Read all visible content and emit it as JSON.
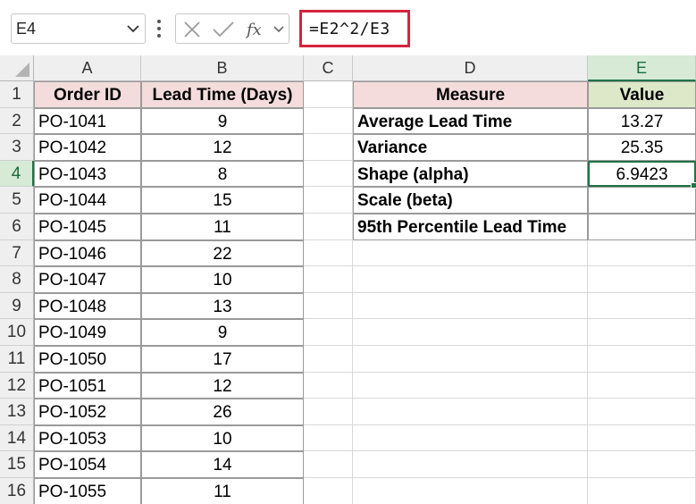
{
  "formula_bar": {
    "name_box": "E4",
    "formula": "=E2^2/E3",
    "icons": [
      "chevron-down-icon",
      "more-vertical-icon",
      "cancel-icon",
      "enter-check-icon",
      "function-icon"
    ]
  },
  "columns": [
    "A",
    "B",
    "C",
    "D",
    "E"
  ],
  "rows": [
    "1",
    "2",
    "3",
    "4",
    "5",
    "6",
    "7",
    "8",
    "9",
    "10",
    "11",
    "12",
    "13",
    "14",
    "15",
    "16"
  ],
  "table_left": {
    "headers": [
      "Order ID",
      "Lead Time (Days)"
    ],
    "rows": [
      [
        "PO-1041",
        "9"
      ],
      [
        "PO-1042",
        "12"
      ],
      [
        "PO-1043",
        "8"
      ],
      [
        "PO-1044",
        "15"
      ],
      [
        "PO-1045",
        "11"
      ],
      [
        "PO-1046",
        "22"
      ],
      [
        "PO-1047",
        "10"
      ],
      [
        "PO-1048",
        "13"
      ],
      [
        "PO-1049",
        "9"
      ],
      [
        "PO-1050",
        "17"
      ],
      [
        "PO-1051",
        "12"
      ],
      [
        "PO-1052",
        "26"
      ],
      [
        "PO-1053",
        "10"
      ],
      [
        "PO-1054",
        "14"
      ],
      [
        "PO-1055",
        "11"
      ]
    ]
  },
  "table_right": {
    "headers": [
      "Measure",
      "Value"
    ],
    "rows": [
      [
        "Average Lead Time",
        "13.27"
      ],
      [
        "Variance",
        "25.35"
      ],
      [
        "Shape (alpha)",
        "6.9423"
      ],
      [
        "Scale (beta)",
        ""
      ],
      [
        "95th Percentile Lead Time",
        ""
      ]
    ]
  },
  "selection": {
    "active_cell": "E4"
  },
  "colors": {
    "selection_green": "#217346",
    "header_pink": "#f4dcdc",
    "header_green": "#dce8c8",
    "formula_highlight": "#d5243f"
  }
}
